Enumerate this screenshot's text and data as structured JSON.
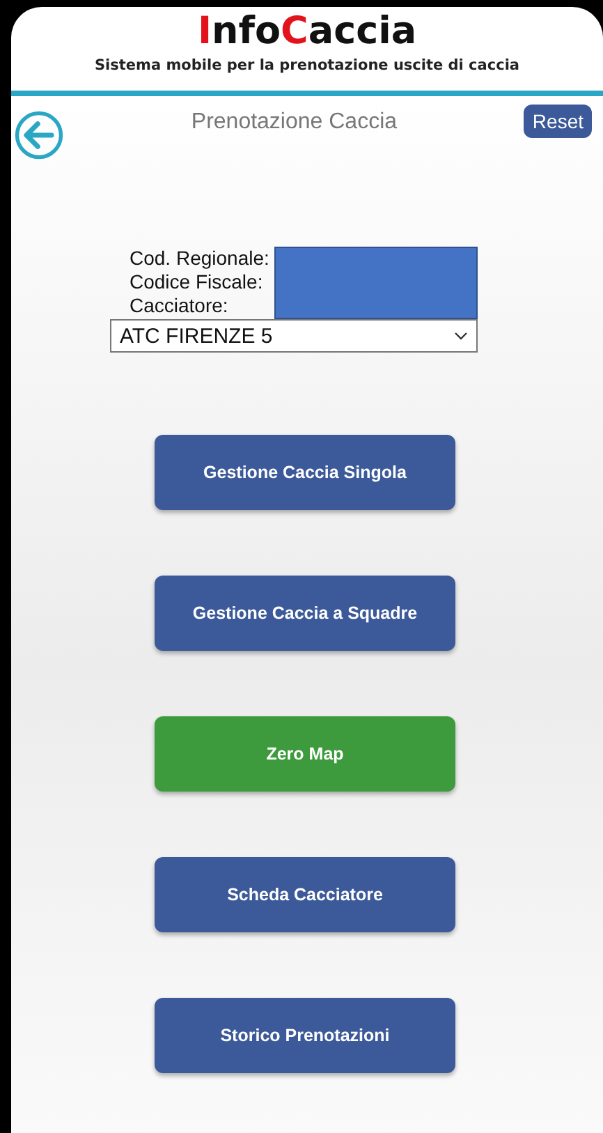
{
  "header": {
    "logo_part_1": "Info",
    "logo_part_2": "Caccia",
    "subtitle": "Sistema mobile per la prenotazione uscite di caccia"
  },
  "toolbar": {
    "title": "Prenotazione Caccia",
    "reset_button": "Reset"
  },
  "profile": {
    "labels": [
      "Cod. Regionale:",
      "Codice Fiscale:",
      "Cacciatore:"
    ],
    "atc_select": "ATC FIRENZE 5"
  },
  "buttons": [
    {
      "label": "Gestione Caccia Singola",
      "color": "#3c5a99"
    },
    {
      "label": "Gestione Caccia a Squadre",
      "color": "#3c5a99"
    },
    {
      "label": "Zero Map",
      "color": "#3d9a3d"
    },
    {
      "label": "Scheda Cacciatore",
      "color": "#3c5a99"
    },
    {
      "label": "Storico Prenotazioni",
      "color": "#3c5a99"
    }
  ]
}
